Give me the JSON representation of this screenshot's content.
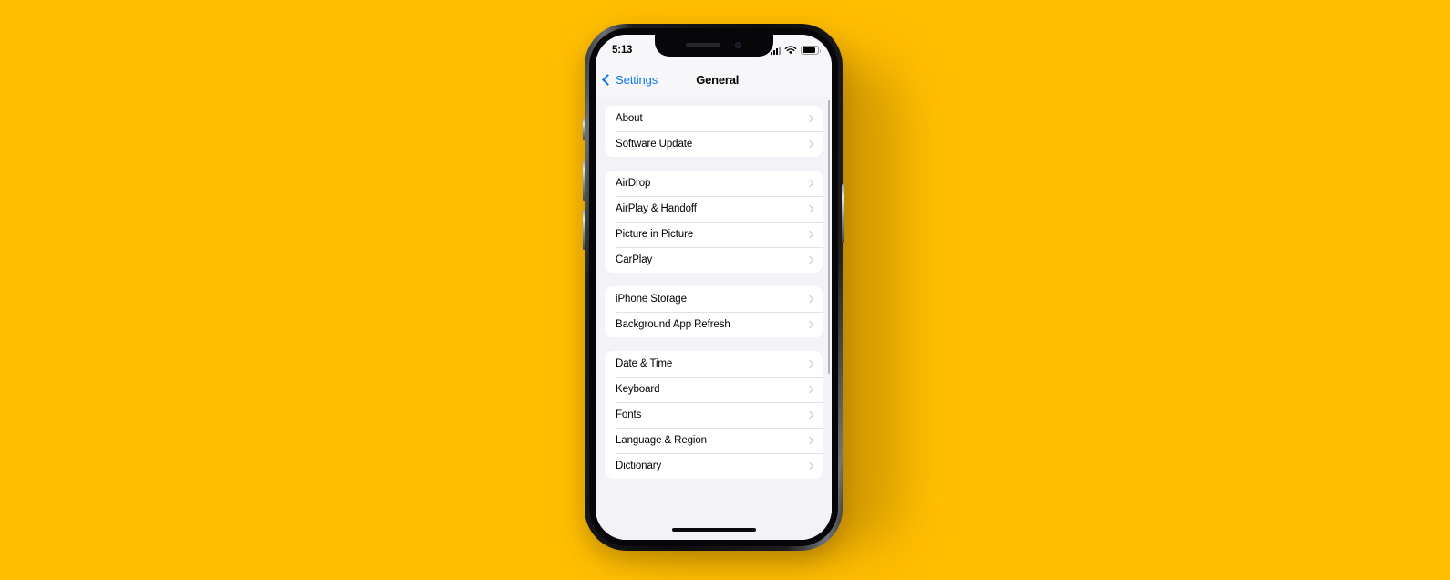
{
  "theme": {
    "background_color": "#FFBE00",
    "screen_background": "#F2F2F7",
    "group_background": "#FFFFFF",
    "accent_color": "#0A78F0",
    "chevron_color": "#C2C2C7",
    "separator_color": "#E3E3E7"
  },
  "status_bar": {
    "time": "5:13",
    "cellular_icon": "signal-bars-icon",
    "wifi_icon": "wifi-icon",
    "battery_icon": "battery-icon"
  },
  "nav_bar": {
    "back_icon": "chevron-left-icon",
    "back_label": "Settings",
    "title": "General"
  },
  "groups": [
    {
      "id": "group-info",
      "rows": [
        {
          "label": "About",
          "accessory": "chevron-right-icon"
        },
        {
          "label": "Software Update",
          "accessory": "chevron-right-icon"
        }
      ]
    },
    {
      "id": "group-connectivity",
      "rows": [
        {
          "label": "AirDrop",
          "accessory": "chevron-right-icon"
        },
        {
          "label": "AirPlay & Handoff",
          "accessory": "chevron-right-icon"
        },
        {
          "label": "Picture in Picture",
          "accessory": "chevron-right-icon"
        },
        {
          "label": "CarPlay",
          "accessory": "chevron-right-icon"
        }
      ]
    },
    {
      "id": "group-storage",
      "rows": [
        {
          "label": "iPhone Storage",
          "accessory": "chevron-right-icon"
        },
        {
          "label": "Background App Refresh",
          "accessory": "chevron-right-icon"
        }
      ]
    },
    {
      "id": "group-locale",
      "rows": [
        {
          "label": "Date & Time",
          "accessory": "chevron-right-icon"
        },
        {
          "label": "Keyboard",
          "accessory": "chevron-right-icon"
        },
        {
          "label": "Fonts",
          "accessory": "chevron-right-icon"
        },
        {
          "label": "Language & Region",
          "accessory": "chevron-right-icon"
        },
        {
          "label": "Dictionary",
          "accessory": "chevron-right-icon"
        }
      ]
    }
  ],
  "device": {
    "notch_speaker": "earpiece-speaker",
    "notch_camera": "front-camera-icon",
    "home_indicator": "home-indicator",
    "buttons": [
      "mute-switch",
      "volume-up-button",
      "volume-down-button",
      "power-button"
    ]
  }
}
